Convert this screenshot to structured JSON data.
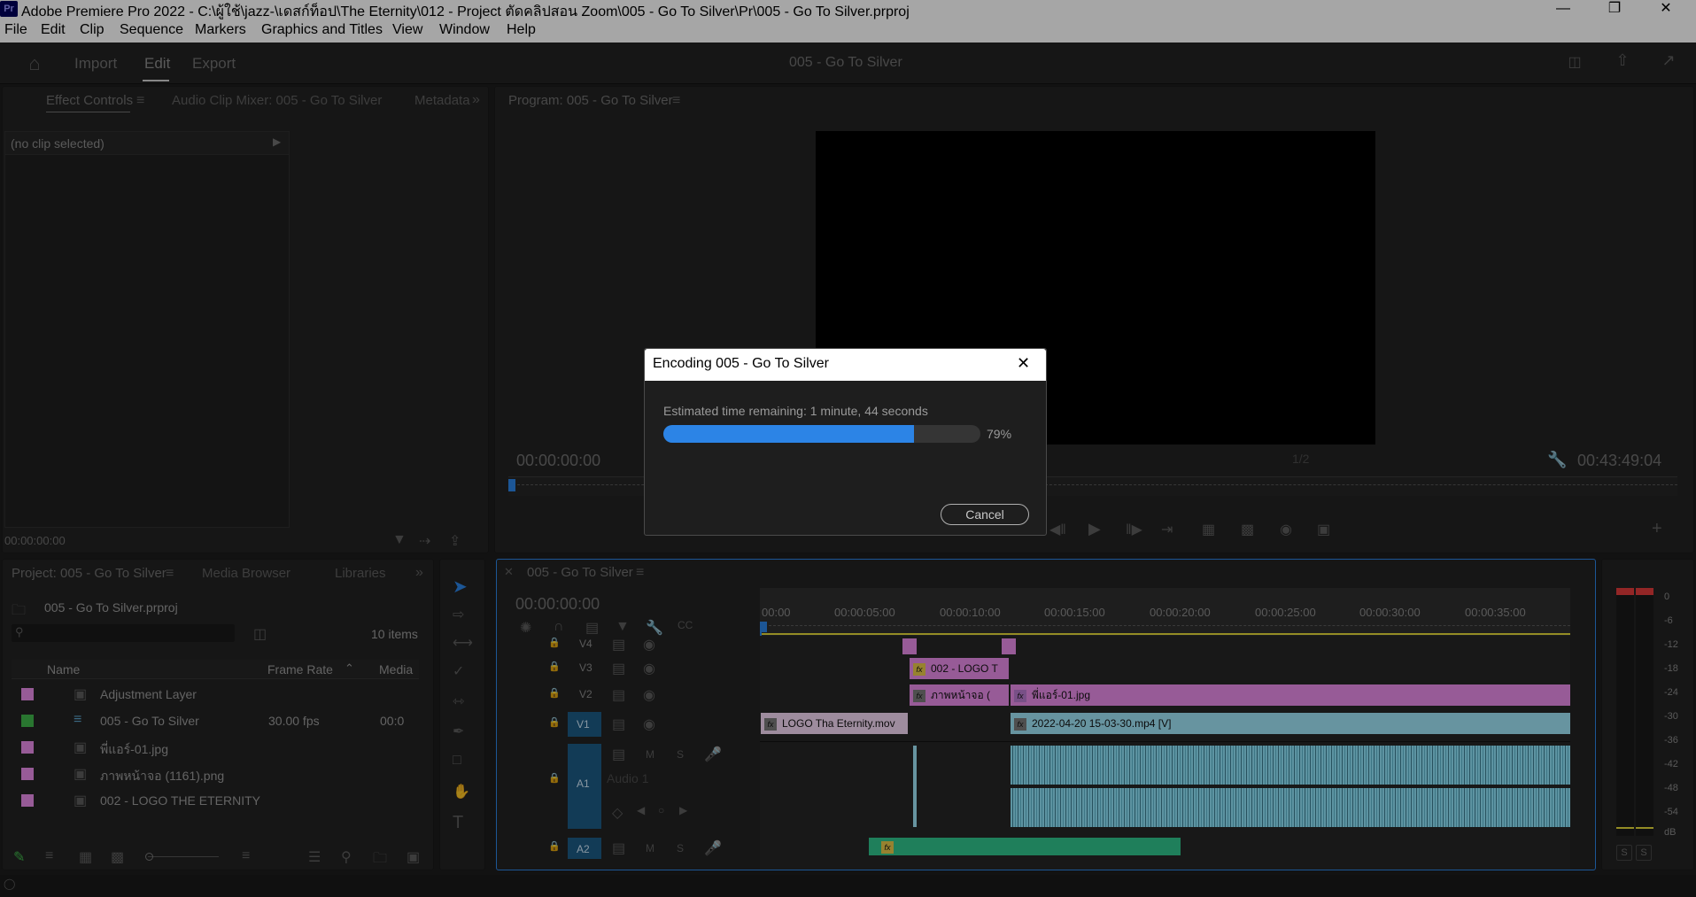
{
  "window": {
    "title": "Adobe Premiere Pro 2022 - C:\\ผู้ใช้\\jazz-\\เดสก์ท็อป\\The Eternity\\012 - Project ตัดคลิปสอน Zoom\\005 - Go To Silver\\Pr\\005 - Go To Silver.prproj",
    "app_icon": "Pr"
  },
  "menu": [
    "File",
    "Edit",
    "Clip",
    "Sequence",
    "Markers",
    "Graphics and Titles",
    "View",
    "Window",
    "Help"
  ],
  "header": {
    "tabs": [
      "Import",
      "Edit",
      "Export"
    ],
    "active_tab": "Edit",
    "sequence_title": "005 - Go To Silver"
  },
  "source_panel": {
    "tabs": [
      "Effect Controls",
      "Audio Clip Mixer: 005 - Go To Silver",
      "Metadata"
    ],
    "no_clip": "(no clip selected)",
    "timecode": "00:00:00:00"
  },
  "program_monitor": {
    "title": "Program: 005 - Go To Silver",
    "timecode_left": "00:00:00:00",
    "timecode_right": "00:43:49:04",
    "resolution": "1/2"
  },
  "project_panel": {
    "tabs": [
      "Project: 005 - Go To Silver",
      "Media Browser",
      "Libraries"
    ],
    "file": "005 - Go To Silver.prproj",
    "item_count": "10 items",
    "columns": [
      "Name",
      "Frame Rate",
      "Media"
    ],
    "items": [
      {
        "name": "Adjustment Layer",
        "fps": "",
        "media": "",
        "color": "#e88de8"
      },
      {
        "name": "005 - Go To Silver",
        "fps": "30.00 fps",
        "media": "00:0",
        "color": "#3fb54a"
      },
      {
        "name": "พี่แอร์-01.jpg",
        "fps": "",
        "media": "",
        "color": "#e88de8"
      },
      {
        "name": "ภาพหน้าจอ (1161).png",
        "fps": "",
        "media": "",
        "color": "#e88de8"
      },
      {
        "name": "002 - LOGO THE ETERNITY",
        "fps": "",
        "media": "",
        "color": "#e88de8"
      }
    ]
  },
  "timeline": {
    "title": "005 - Go To Silver",
    "timecode": "00:00:00:00",
    "ruler": [
      "00:00",
      "00:00:05:00",
      "00:00:10:00",
      "00:00:15:00",
      "00:00:20:00",
      "00:00:25:00",
      "00:00:30:00",
      "00:00:35:00"
    ],
    "tracks": [
      "V4",
      "V3",
      "V2",
      "V1",
      "A1",
      "A2"
    ],
    "a1_label": "Audio 1",
    "clips": {
      "v3_logo": "002 - LOGO T",
      "v2_screen": "ภาพหน้าจอ (",
      "v2_image": "พี่แอร์-01.jpg",
      "v1_logo": "LOGO Tha Eternity.mov",
      "v1_video": "2022-04-20 15-03-30.mp4 [V]"
    }
  },
  "meter": {
    "scale": [
      "0",
      "-6",
      "-12",
      "-18",
      "-24",
      "-30",
      "-36",
      "-42",
      "-48",
      "-54",
      "dB"
    ],
    "solo": [
      "S",
      "S"
    ]
  },
  "dialog": {
    "title": "Encoding 005 - Go To Silver",
    "estimate": "Estimated time remaining: 1 minute, 44 seconds",
    "percent_label": "79%",
    "progress": 0.79,
    "cancel": "Cancel"
  },
  "colors": {
    "accent": "#2c84e6",
    "video_clip": "#e88de8",
    "video_clip_blue": "#9fe3f6",
    "audio_green": "#30c48d",
    "track_target": "#1d5b85"
  }
}
